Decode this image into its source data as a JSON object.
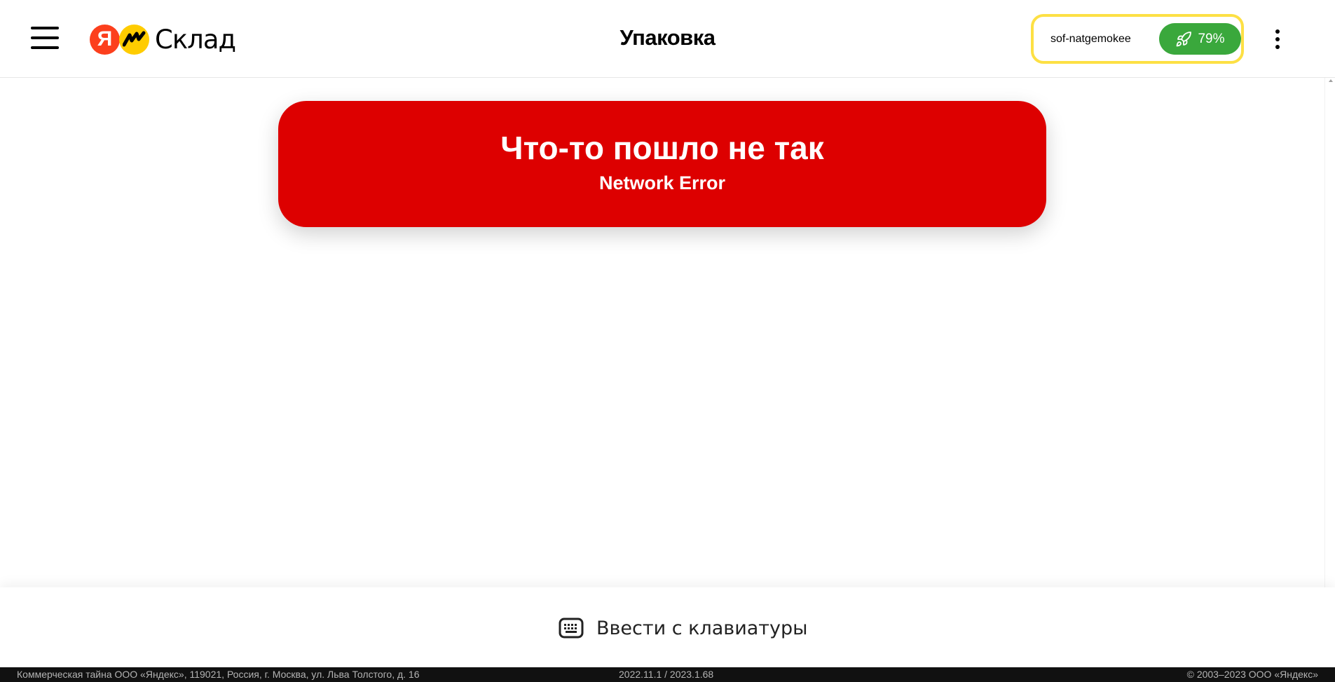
{
  "header": {
    "logo_letter": "Я",
    "logo_text": "Склад",
    "title": "Упаковка",
    "user_name": "sof-natgemokee",
    "progress": "79%",
    "progress_value": 79
  },
  "error": {
    "title": "Что-то пошло не так",
    "subtitle": "Network Error"
  },
  "actions": {
    "keyboard_label": "Ввести с клавиатуры"
  },
  "footer": {
    "left": "Коммерческая тайна ООО «Яндекс», 119021, Россия, г. Москва, ул. Льва Толстого, д. 16",
    "center": "2022.11.1 / 2023.1.68",
    "right": "© 2003–2023 ООО «Яндекс»"
  },
  "colors": {
    "error_bg": "#dd0000",
    "progress_bg": "#3aa83c",
    "user_border": "#fde044",
    "yandex_red": "#fc3f1d",
    "market_yellow": "#ffcc00",
    "footer_bg": "#111111"
  },
  "icons": {
    "menu": "menu-icon",
    "logo": "yandex-market-logo",
    "rocket": "rocket-icon",
    "more": "more-vertical-icon",
    "keyboard": "keyboard-icon"
  }
}
